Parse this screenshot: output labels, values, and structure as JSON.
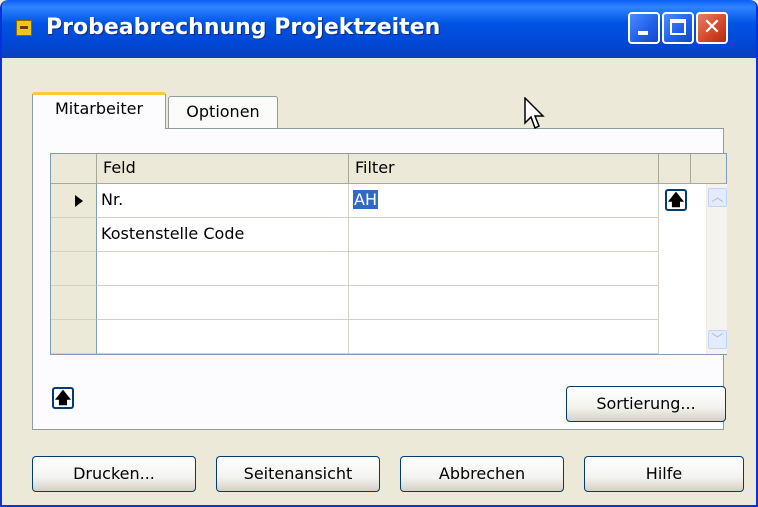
{
  "window": {
    "title": "Probeabrechnung Projektzeiten",
    "close_glyph": "✕"
  },
  "tabs": [
    {
      "label": "Mitarbeiter",
      "active": true
    },
    {
      "label": "Optionen",
      "active": false
    }
  ],
  "grid": {
    "columns": [
      "Feld",
      "Filter"
    ],
    "rows": [
      {
        "field": "Nr.",
        "filter": "AH",
        "current": true
      },
      {
        "field": "Kostenstelle Code",
        "filter": ""
      },
      {
        "field": "",
        "filter": ""
      },
      {
        "field": "",
        "filter": ""
      },
      {
        "field": "",
        "filter": ""
      }
    ]
  },
  "icons": {
    "row_lookup": "up-arrow-icon",
    "scroll_up": "scroll-up-icon",
    "scroll_down": "scroll-down-icon",
    "move_up": "up-arrow-icon"
  },
  "buttons": {
    "sort": "Sortierung...",
    "print": "Drucken...",
    "preview": "Seitenansicht",
    "cancel": "Abbrechen",
    "help": "Hilfe"
  },
  "colors": {
    "title_bar": "#0054e3",
    "selection": "#316ac5",
    "close_button": "#d6492a",
    "active_tab_accent": "#ffc83c"
  }
}
